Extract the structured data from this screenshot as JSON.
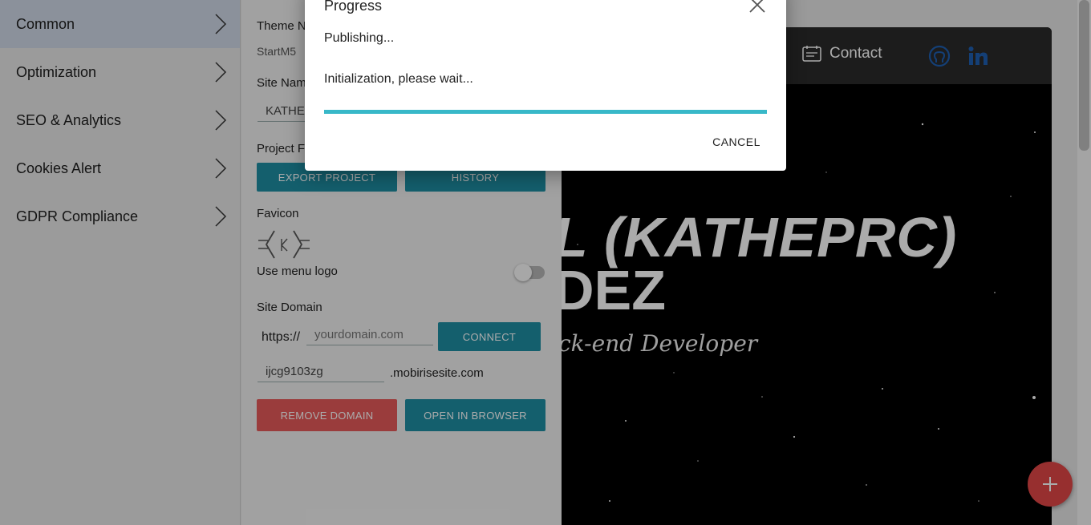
{
  "sidebar": {
    "items": [
      {
        "label": "Common"
      },
      {
        "label": "Optimization"
      },
      {
        "label": "SEO & Analytics"
      },
      {
        "label": "Cookies Alert"
      },
      {
        "label": "GDPR Compliance"
      }
    ]
  },
  "panel": {
    "theme_label": "Theme N",
    "theme_value": "StartM5",
    "site_name_label": "Site Nam",
    "site_name_value": "KATHEP",
    "project_label": "Project F",
    "export_label": "EXPORT PROJECT",
    "history_label": "HISTORY",
    "favicon_label": "Favicon",
    "use_menu_logo_label": "Use menu logo",
    "use_menu_logo_on": false,
    "site_domain_label": "Site Domain",
    "domain_prefix": "https://",
    "domain_placeholder": "yourdomain.com",
    "connect_label": "CONNECT",
    "subdomain_value": "ijcg9103zg",
    "subdomain_suffix": ".mobirisesite.com",
    "remove_domain_label": "REMOVE DOMAIN",
    "open_browser_label": "OPEN IN BROWSER"
  },
  "preview": {
    "nav_contact": "Contact",
    "hero_line1": "L (KATHEPRC)",
    "hero_line2": "DEZ",
    "hero_subtitle": "ck-end Developer"
  },
  "dialog": {
    "title": "Progress",
    "status": "Publishing...",
    "message": "Initialization, please wait...",
    "progress": 1.0,
    "cancel_label": "CANCEL"
  },
  "colors": {
    "accent": "#1f8ea3",
    "danger": "#e65a5a",
    "progress": "#38b8c8",
    "fab": "#e14646"
  }
}
